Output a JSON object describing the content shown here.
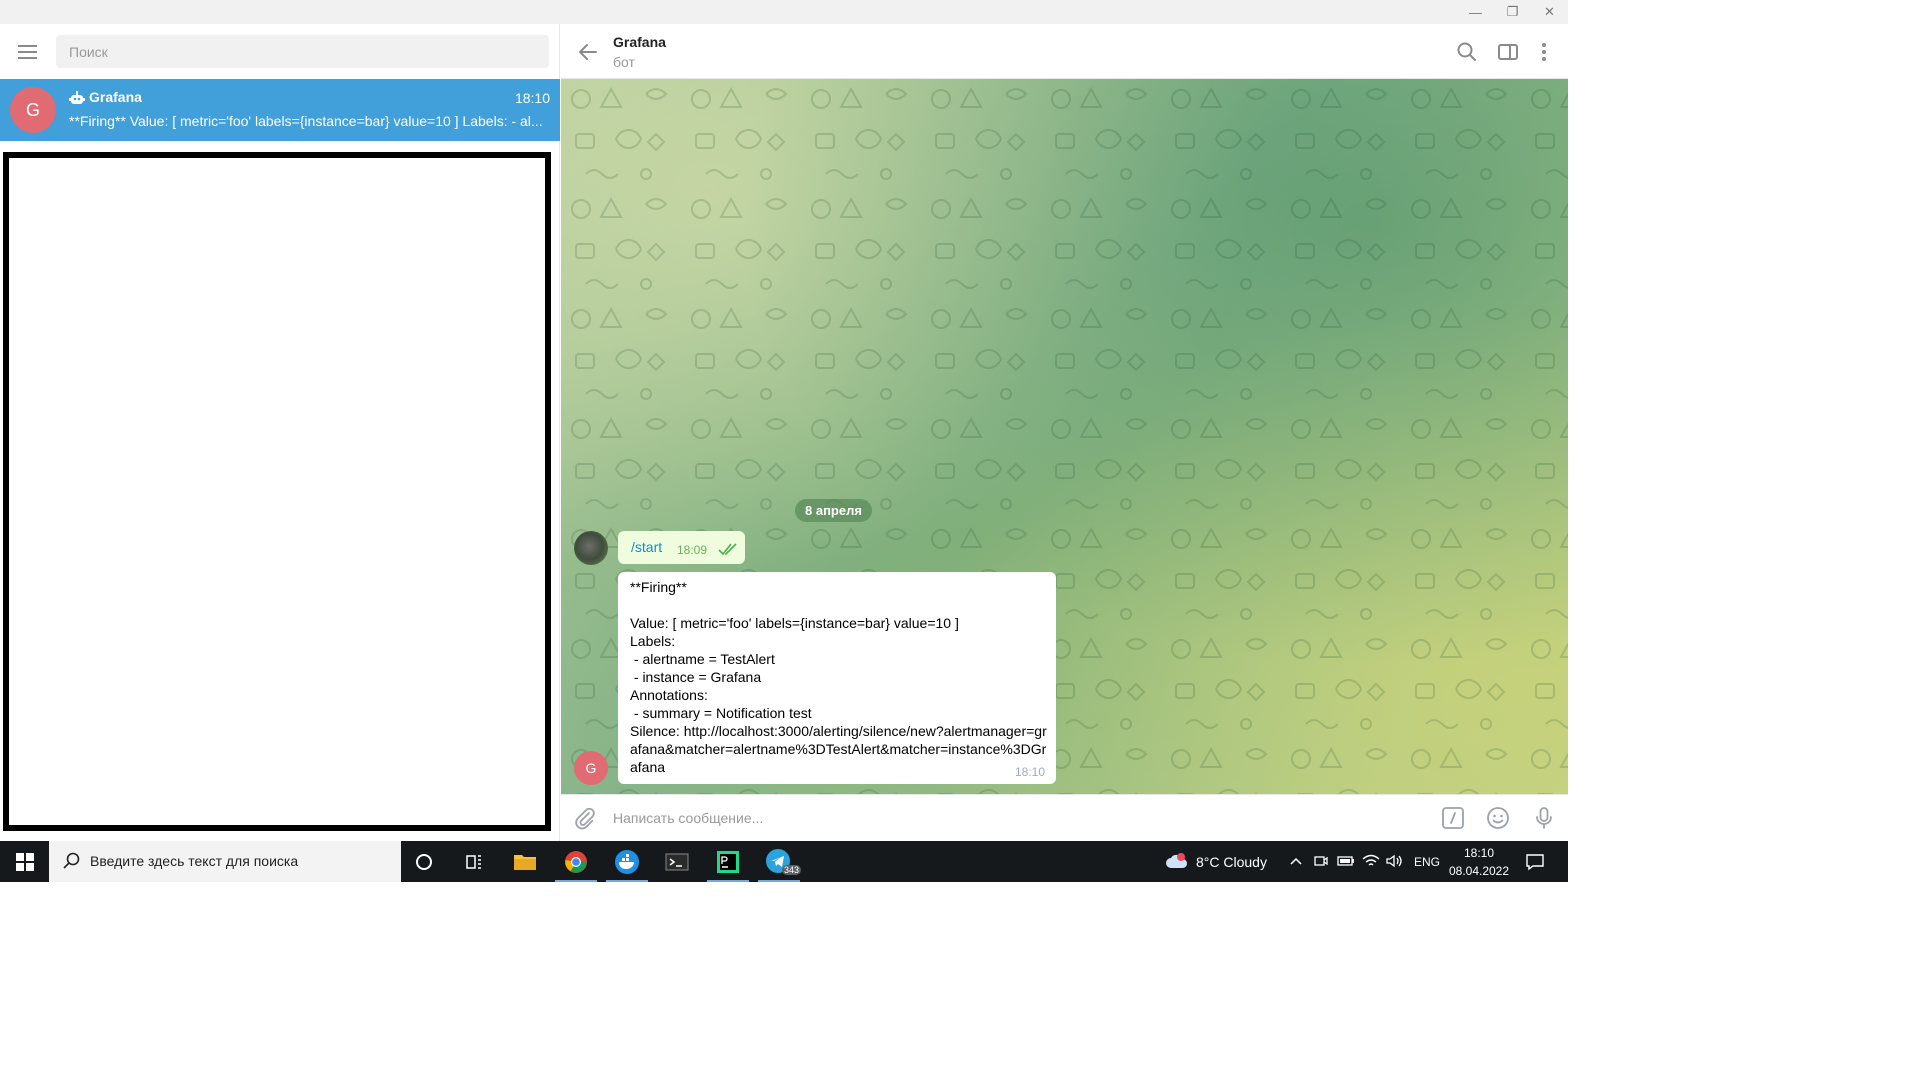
{
  "window": {
    "controls": {
      "minimize": "—",
      "restore": "❐",
      "close": "✕"
    }
  },
  "sidebar": {
    "search_placeholder": "Поиск",
    "chat_item": {
      "avatar_letter": "G",
      "name": "Grafana",
      "time": "18:10",
      "preview": "**Firing**  Value: [ metric='foo' labels={instance=bar} value=10 ] Labels:  - al..."
    }
  },
  "chat": {
    "header": {
      "name": "Grafana",
      "status": "бот"
    },
    "date_separator": "8 апреля",
    "messages": {
      "outgoing": {
        "text": "/start",
        "time": "18:09"
      },
      "incoming": {
        "avatar_letter": "G",
        "text": "**Firing**\n\nValue: [ metric='foo' labels={instance=bar} value=10 ]\nLabels:\n - alertname = TestAlert\n - instance = Grafana\nAnnotations:\n - summary = Notification test\nSilence: http://localhost:3000/alerting/silence/new?alertmanager=grafana&matcher=alertname%3DTestAlert&matcher=instance%3DGrafana",
        "time": "18:10"
      }
    },
    "composer_placeholder": "Написать сообщение..."
  },
  "taskbar": {
    "search_placeholder": "Введите здесь текст для поиска",
    "telegram_badge": "343",
    "weather": "8°C  Cloudy",
    "language": "ENG",
    "clock_time": "18:10",
    "clock_date": "08.04.2022"
  },
  "colors": {
    "accent": "#419fd9",
    "avatar_red": "#e06b72",
    "outgoing_bubble": "#effdde",
    "taskbar": "#16191c"
  }
}
